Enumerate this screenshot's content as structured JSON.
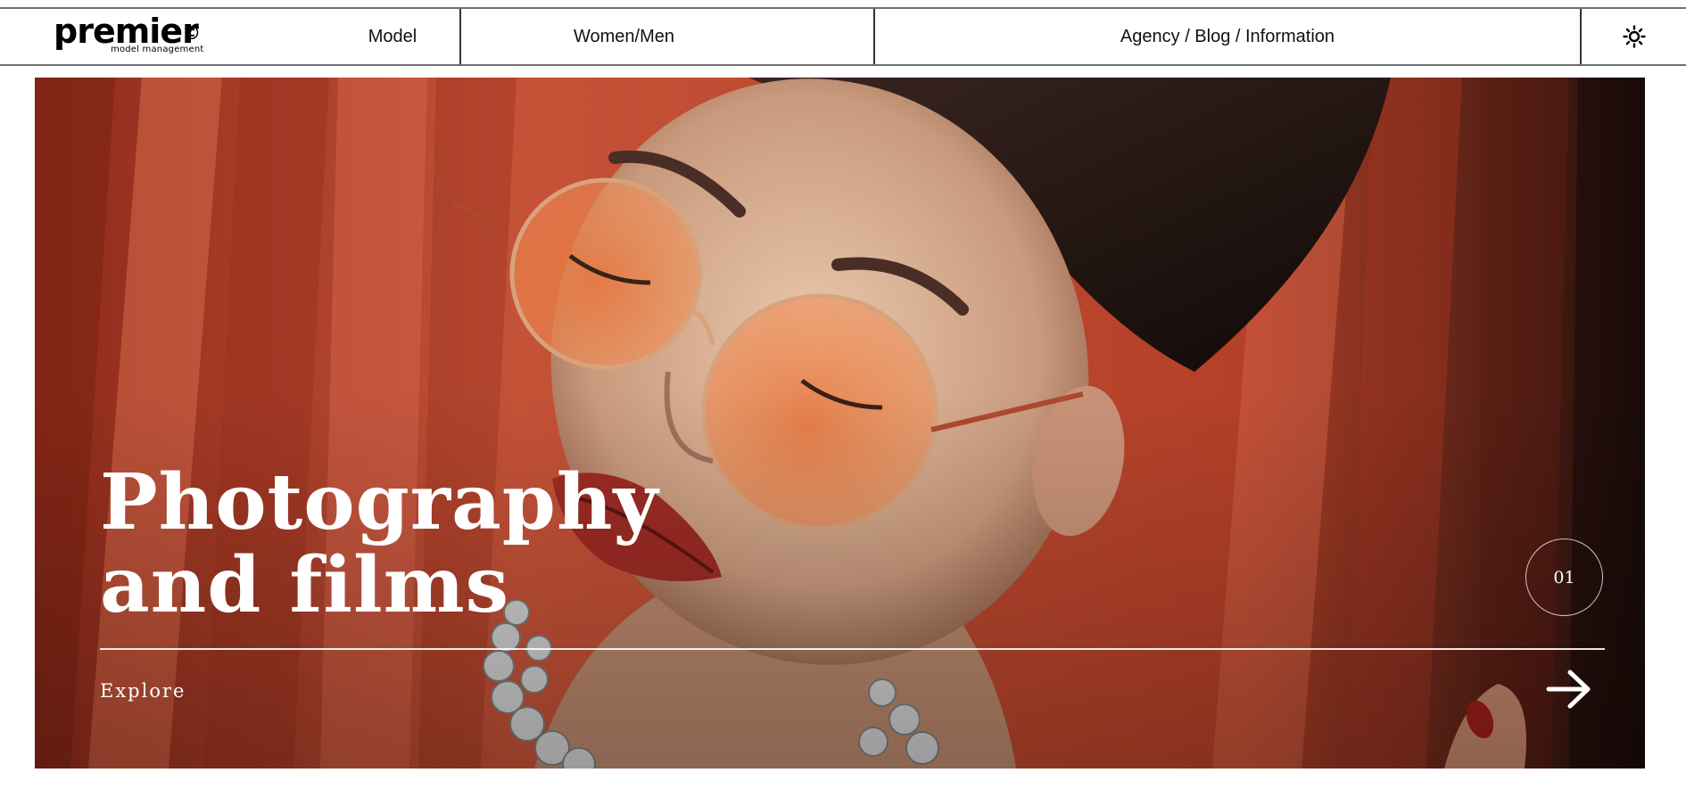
{
  "header": {
    "logo": {
      "brand": "premier",
      "mark": "©",
      "sub": "model management"
    },
    "nav": {
      "model": "Model",
      "women_men": "Women/Men",
      "agency": "Agency / Blog / Information"
    },
    "theme_icon": "sun-icon"
  },
  "hero": {
    "title_line1": "Photography",
    "title_line2": "and films",
    "counter": "01",
    "explore": "Explore",
    "arrow_icon": "arrow-right-icon",
    "colors": {
      "backdrop": "#b5452e",
      "text": "#ffffff"
    }
  }
}
